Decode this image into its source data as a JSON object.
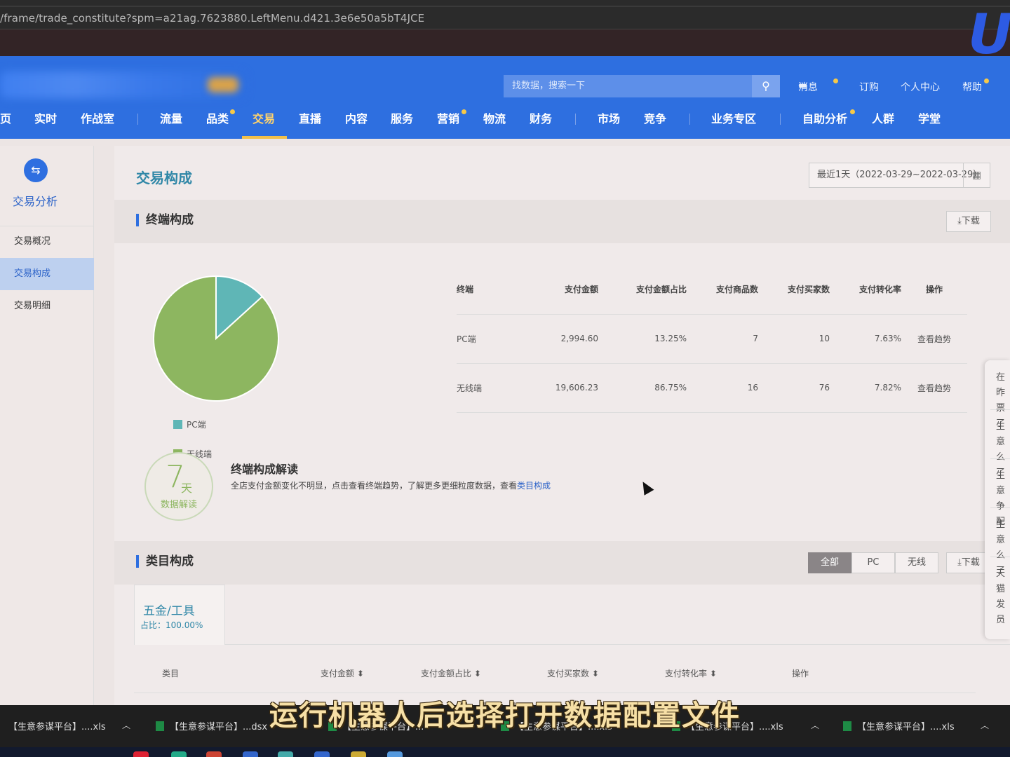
{
  "browser": {
    "url": "/frame/trade_constitute?spm=a21ag.7623880.LeftMenu.d421.3e6e50a5bT4JCE"
  },
  "header": {
    "search_placeholder": "找数据，搜索一下",
    "top_links": [
      "消息",
      "订购",
      "个人中心",
      "帮助"
    ],
    "nav": [
      "页",
      "实时",
      "作战室",
      "流量",
      "品类",
      "交易",
      "直播",
      "内容",
      "服务",
      "营销",
      "物流",
      "财务",
      "市场",
      "竞争",
      "业务专区",
      "自助分析",
      "人群",
      "学堂"
    ],
    "active_nav": "交易",
    "accent": "#2e6fe0"
  },
  "sidebar": {
    "title": "交易分析",
    "items": [
      "交易概况",
      "交易构成",
      "交易明细"
    ],
    "active": "交易构成"
  },
  "main": {
    "page_title": "交易构成",
    "date_range": "最近1天（2022-03-29~2022-03-29）",
    "calendar_icon": "calendar-icon",
    "terminal": {
      "title": "终端构成",
      "download": "下载",
      "columns": [
        "终端",
        "支付金额",
        "支付金额占比",
        "支付商品数",
        "支付买家数",
        "支付转化率",
        "操作"
      ],
      "rows": [
        [
          "PC端",
          "2,994.60",
          "13.25%",
          "7",
          "10",
          "7.63%",
          "查看趋势"
        ],
        [
          "无线端",
          "19,606.23",
          "86.75%",
          "16",
          "76",
          "7.82%",
          "查看趋势"
        ]
      ],
      "legend": [
        "PC端",
        "无线端"
      ],
      "interp": {
        "badge_num": "7",
        "badge_unit": "天",
        "badge_label": "数据解读",
        "title": "终端构成解读",
        "text": "全店支付金额变化不明显，点击查看终端趋势，了解更多更细粒度数据，查看",
        "link": "类目构成"
      }
    },
    "category": {
      "title": "类目构成",
      "filters": [
        "全部",
        "PC",
        "无线"
      ],
      "active_filter": "全部",
      "download": "下载",
      "tab_name": "五金/工具",
      "tab_share": "占比：100.00%",
      "columns": [
        "类目",
        "支付金额 ⬍",
        "支付金额占比 ⬍",
        "支付买家数 ⬍",
        "支付转化率 ⬍",
        "操作"
      ]
    },
    "right_panel": [
      "在昨",
      "票了",
      "生意",
      "么了",
      "生意",
      "争配",
      "生意",
      "么了",
      "天猫",
      "发员"
    ]
  },
  "chart_data": {
    "type": "pie",
    "categories": [
      "PC端",
      "无线端"
    ],
    "values": [
      13.25,
      86.75
    ],
    "colors": [
      "#5fb6b6",
      "#8db660"
    ]
  },
  "taskbar": {
    "items": [
      "【生意参谋平台】....xls",
      "【生意参谋平台】...dsx",
      "【生意参谋平台】...",
      "【生意参谋平台】....xls",
      "【生意参谋平台】....xls",
      "【生意参谋平台】....xls"
    ]
  },
  "caption": "运行机器人后选择打开数据配置文件"
}
